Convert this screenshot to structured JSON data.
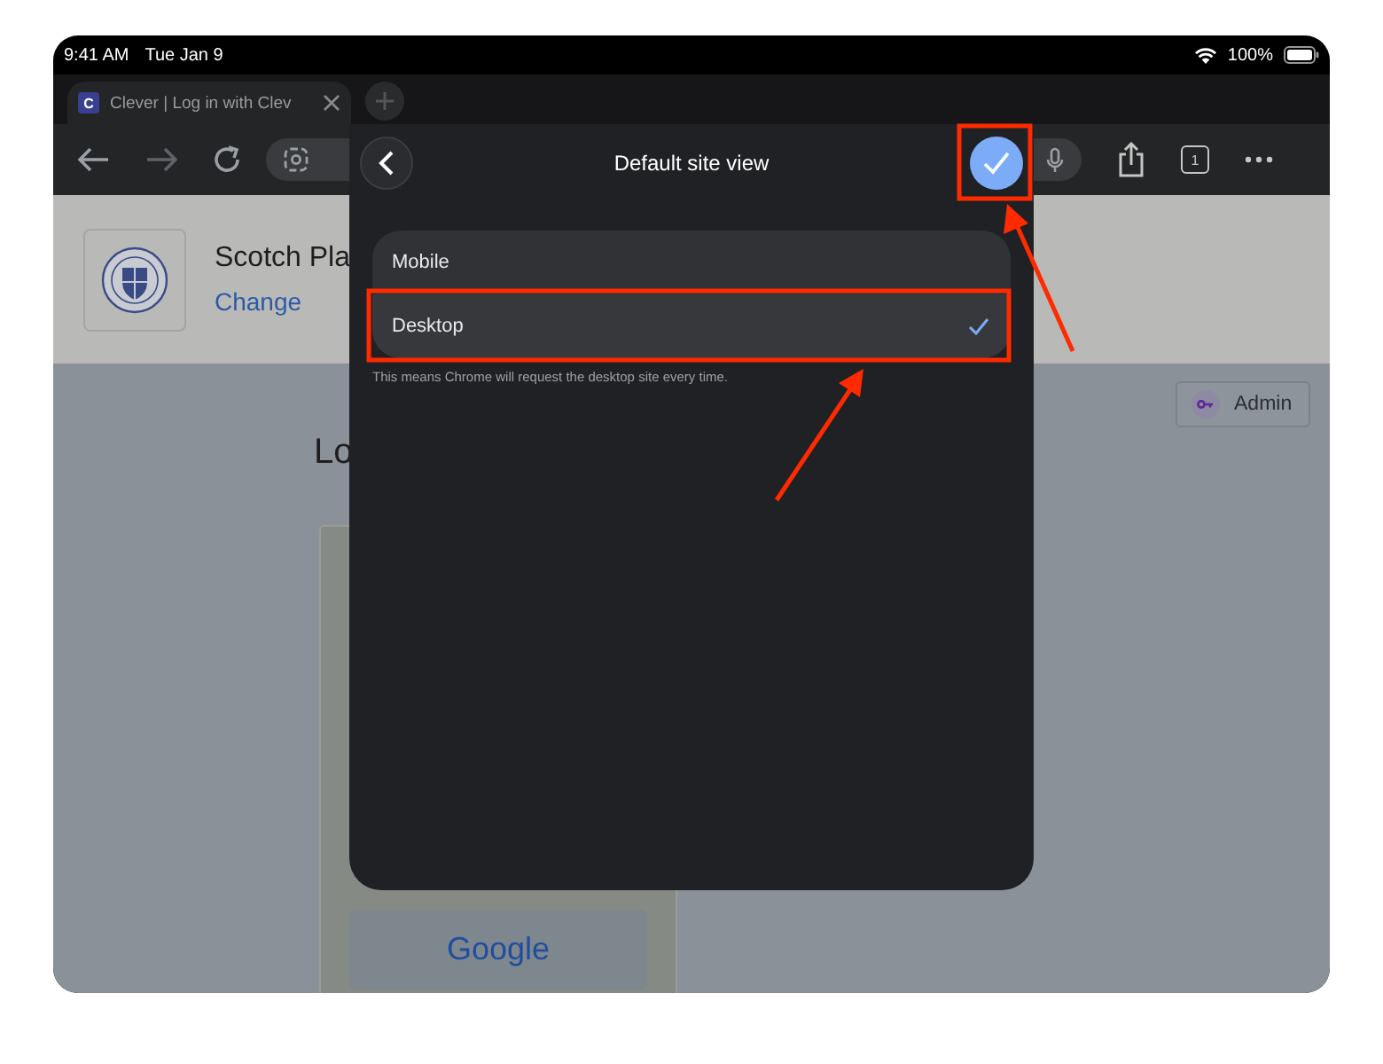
{
  "status_bar": {
    "time": "9:41 AM",
    "date": "Tue Jan 9",
    "battery": "100%"
  },
  "tabs": [
    {
      "favicon": "C",
      "title": "Clever | Log in with Clev",
      "selected": true
    }
  ],
  "toolbar": {
    "tab_count": "1"
  },
  "page": {
    "district_name": "Scotch Pla",
    "change_link": "Change",
    "admin_button": "Admin",
    "heading": "Lo",
    "login_button": "Google"
  },
  "dialog": {
    "title": "Default site view",
    "options": [
      {
        "label": "Mobile",
        "selected": false
      },
      {
        "label": "Desktop",
        "selected": true
      }
    ],
    "note": "This means Chrome will request the desktop site every time."
  }
}
